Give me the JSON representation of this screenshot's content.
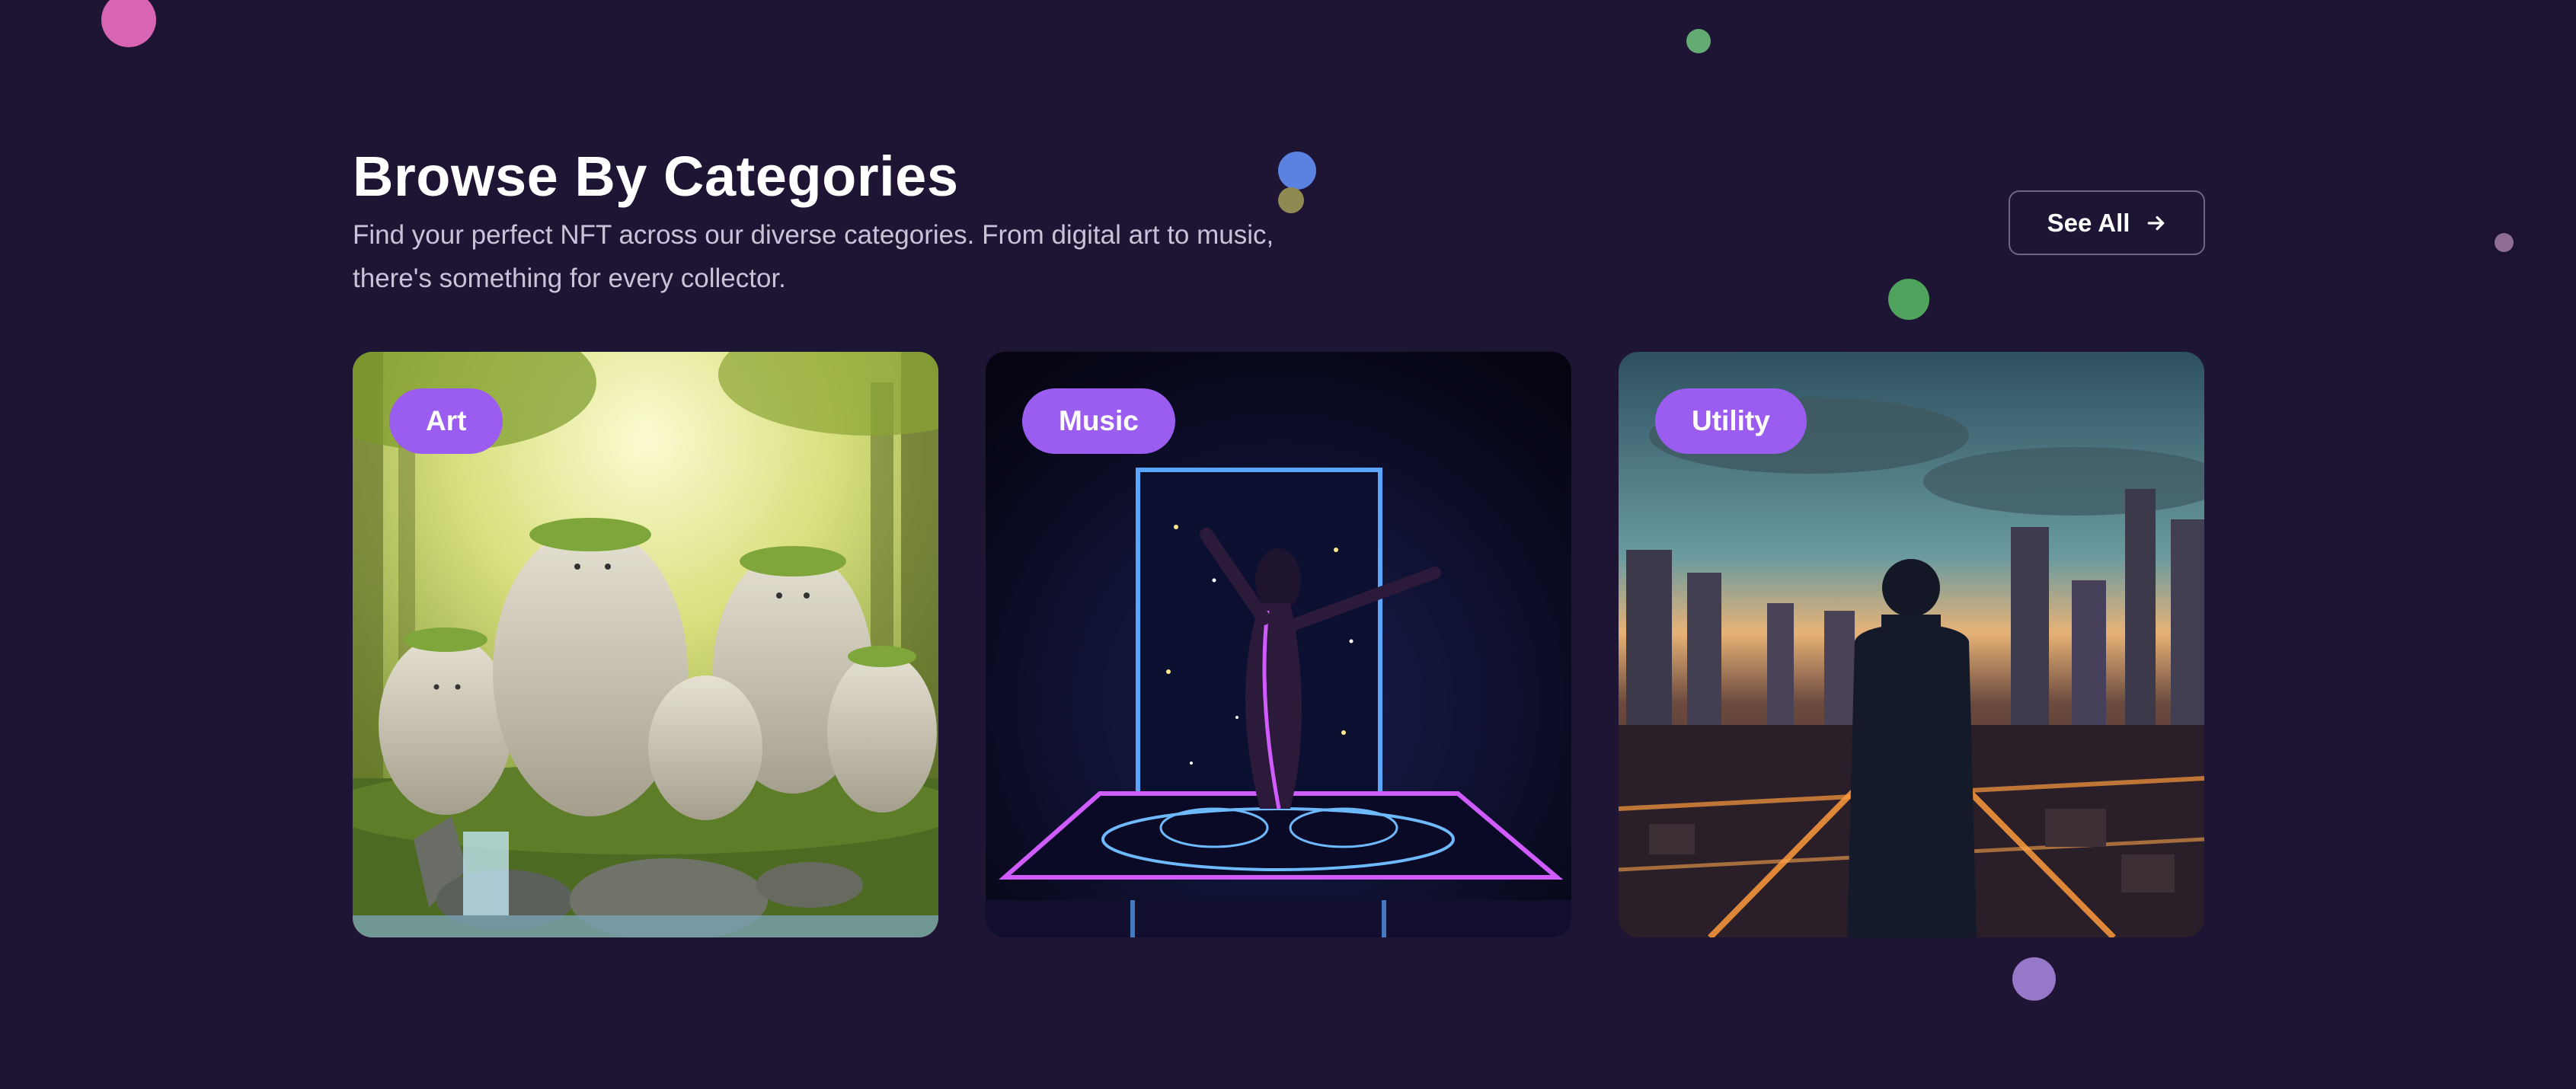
{
  "section": {
    "title": "Browse By Categories",
    "description": "Find your perfect NFT across our diverse categories. From digital art to music, there's something for every collector.",
    "see_all_label": "See All",
    "see_all_icon": "arrow-right-icon"
  },
  "categories": [
    {
      "label": "Art",
      "image": "stone-creatures-forest-artwork"
    },
    {
      "label": "Music",
      "image": "neon-dancer-stage-artwork"
    },
    {
      "label": "Utility",
      "image": "city-skyline-businessman-artwork"
    }
  ],
  "colors": {
    "background": "#1e1434",
    "badge": "#9b5cf0",
    "text": "#ffffff",
    "muted_text": "#c9c2d8"
  }
}
